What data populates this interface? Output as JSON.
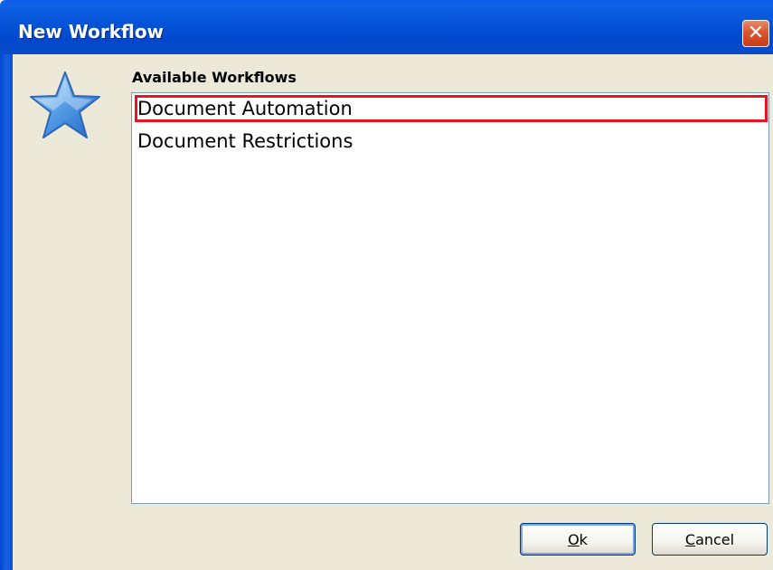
{
  "window": {
    "title": "New Workflow",
    "close_glyph": "✕"
  },
  "main": {
    "icon": "star-icon",
    "list_label": "Available Workflows",
    "items": [
      {
        "label": "Document Automation",
        "selected": true
      },
      {
        "label": "Document Restrictions",
        "selected": false
      }
    ]
  },
  "buttons": {
    "ok": {
      "mnemonic": "O",
      "rest": "k"
    },
    "cancel": {
      "mnemonic": "C",
      "rest": "ancel"
    }
  },
  "colors": {
    "titlebar": "#0453d6",
    "client": "#ece9d8",
    "selection_outline": "#e8141f"
  }
}
